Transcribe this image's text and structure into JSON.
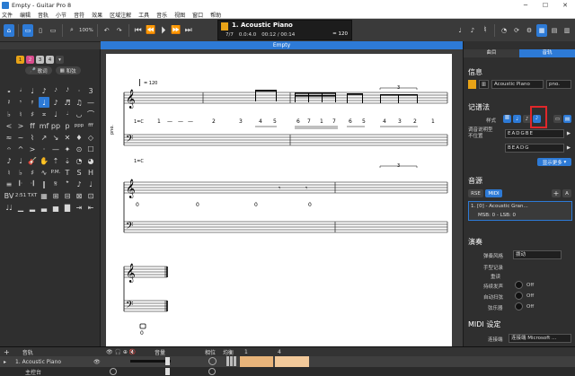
{
  "window": {
    "title": "Empty - Guitar Pro 8"
  },
  "menu": [
    "文件",
    "编辑",
    "音轨",
    "小节",
    "音符",
    "效果",
    "区域注解",
    "工具",
    "音乐",
    "视图",
    "窗口",
    "帮助"
  ],
  "toolbar": {
    "zoom": "100%"
  },
  "lcd": {
    "track_name": "1. Acoustic Piano",
    "bar_pos": "7/7",
    "beat_pos": "0.0:4.0",
    "time": "00:12 / 00:14",
    "tempo": "= 120"
  },
  "document": {
    "title": "Empty"
  },
  "left_panel": {
    "voices": [
      "1",
      "2",
      "3",
      "4"
    ],
    "btn_left": "歌词",
    "btn_right": "和弦"
  },
  "score": {
    "tempo_mark": "= 120",
    "track_abbr": "pno.",
    "chord_1c": "1=C",
    "notation_row1": [
      "1",
      "—",
      "—",
      "—",
      "2",
      "—",
      "3",
      "4",
      "5",
      "6",
      "7",
      "1",
      "7",
      "6",
      "5",
      "4",
      "3",
      "2",
      "1",
      "7"
    ],
    "tab_row2": [
      "0",
      "0",
      "0",
      "0"
    ]
  },
  "right_panel": {
    "tabs": [
      "曲目",
      "音轨"
    ],
    "info_header": "信息",
    "track_name": "Acoustic Piano",
    "track_short": "pno.",
    "notation_header": "记谱法",
    "style_label": "样式",
    "tuning_label": "调音说明型\n不位置",
    "tuning1": "EADGBE",
    "tuning2": "BEADG",
    "show_more": "显示更多",
    "sound_header": "音源",
    "rse": "RSE",
    "midi": "MIDI",
    "sound_item": "1. [0] - Acoustic Gran...",
    "msb": "MSB: 0 - LSB: 0",
    "perf_header": "演奏",
    "perf_style_label": "弹奏风格",
    "perf_style_value": "拨动",
    "hand_label": "手型记录",
    "weight_label": "重读",
    "sustain_label": "持续发声",
    "sustain_value": "Off",
    "auto_label": "自动扫弦",
    "auto_value": "Off",
    "strum_label": "弦乐器",
    "strum_value": "Off",
    "midi_header": "MIDI 设定",
    "port_label": "连接端",
    "port_value": "连接端 Microsoft ..."
  },
  "bottom": {
    "col_track": "音轨",
    "col_vol": "音量",
    "col_pan": "相位",
    "col_eq": "均衡",
    "ruler1": "1",
    "ruler4": "4",
    "track1": "1. Acoustic Piano",
    "master": "主控台"
  }
}
